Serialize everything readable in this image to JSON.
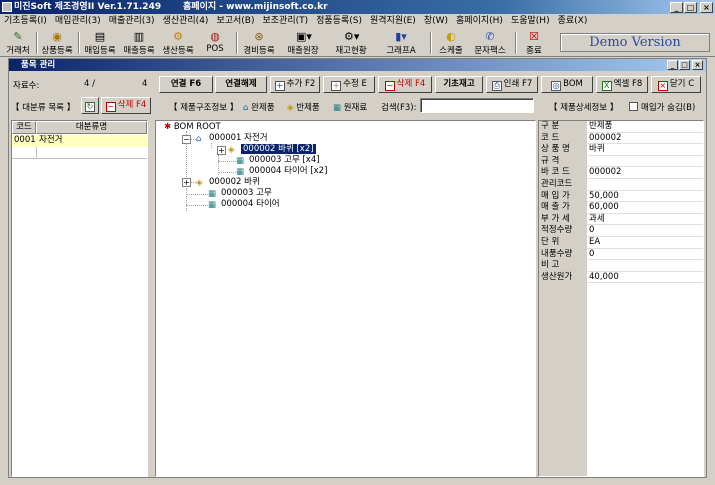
{
  "titlebar": {
    "title": "미진Soft 제조경영II Ver.1.71.249       홈페이지 - www.mijinsoft.co.kr"
  },
  "menubar": [
    "기초등록(I)",
    "매입관리(3)",
    "매출관리(3)",
    "생산관리(4)",
    "보고서(B)",
    "보조관리(T)",
    "정품등록(S)",
    "원격지원(E)",
    "창(W)",
    "홈페이지(H)",
    "도움말(H)",
    "종료(X)"
  ],
  "toolbar": {
    "items": [
      "거래처",
      "상품등록",
      "매입등록",
      "매출등록",
      "생산등록",
      "POS",
      "경비등록",
      "매출원장",
      "재고현황",
      "그래프A",
      "스케줄",
      "문자팩스",
      "종료"
    ],
    "demo": "Demo Version"
  },
  "child": {
    "title": "품목 관리",
    "record_label": "자료수:",
    "record_current": "4 /",
    "record_total": "4",
    "buttons": {
      "connect": "연결 F6",
      "disconnect": "연결해제",
      "add": "추가 F2",
      "edit": "수정 E",
      "delete": "삭제 F4",
      "base_stock": "기초재고",
      "print": "인쇄 F7",
      "bom": "BOM",
      "excel": "엑셀 F8",
      "close": "닫기 C"
    },
    "category_section": "【 대분류 목록 】",
    "category_delete": "삭제 F4",
    "structure_section": "【 제품구조정보 】",
    "legend": {
      "finished": "완제품",
      "semi": "반제품",
      "raw": "원재료"
    },
    "search_label": "검색(F3):",
    "search_value": "",
    "detail_section": "【 제품상세정보 】",
    "hide_purchase": "매입가 숨김(B)"
  },
  "category_table": {
    "headers": [
      "코드",
      "대분류명"
    ],
    "rows": [
      {
        "code": "0001",
        "name": "자전거"
      }
    ]
  },
  "tree": [
    {
      "label": "BOM ROOT",
      "level": 0
    },
    {
      "label": "000001 자전거",
      "level": 1
    },
    {
      "label": "000002 바퀴 [x2]",
      "level": 2,
      "selected": true
    },
    {
      "label": "000003 고무 [x4]",
      "level": 3
    },
    {
      "label": "000004 타이어 [x2]",
      "level": 3
    },
    {
      "label": "000002 바퀴",
      "level": 1
    },
    {
      "label": "000003 고무",
      "level": 1
    },
    {
      "label": "000004 타이어",
      "level": 1
    }
  ],
  "detail": [
    {
      "label": "구   분",
      "value": "반제품"
    },
    {
      "label": "코     드",
      "value": "000002"
    },
    {
      "label": "상 품 명",
      "value": "바퀴"
    },
    {
      "label": "규     격",
      "value": ""
    },
    {
      "label": "바 코 드",
      "value": "000002"
    },
    {
      "label": "관리코드",
      "value": ""
    },
    {
      "label": "매 입 가",
      "value": "50,000"
    },
    {
      "label": "매 출 가",
      "value": "60,000"
    },
    {
      "label": "부 가 세",
      "value": "과세"
    },
    {
      "label": "적정수량",
      "value": "0"
    },
    {
      "label": "단     위",
      "value": "EA"
    },
    {
      "label": "내품수량",
      "value": "0"
    },
    {
      "label": "비     고",
      "value": ""
    },
    {
      "label": "생산원가",
      "value": "40,000"
    }
  ],
  "colors": {
    "title_start": "#0a246a",
    "title_end": "#a6caf0",
    "selected_row": "#ffffc0",
    "tree_selected": "#0a246a",
    "delete_red": "#cc0000"
  }
}
